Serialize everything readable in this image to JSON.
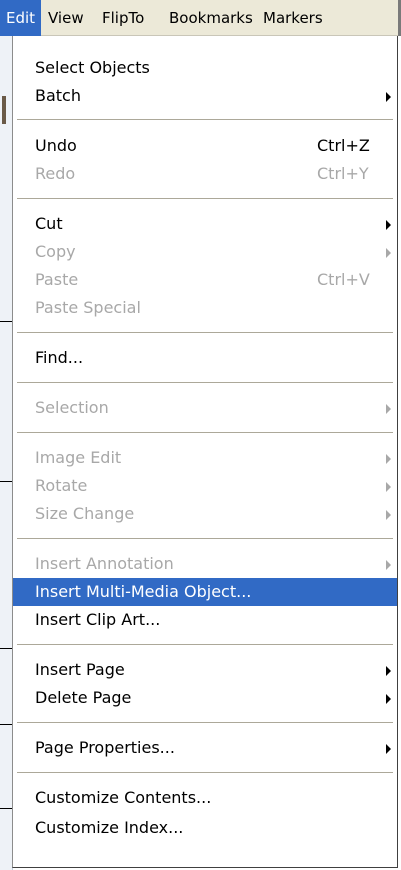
{
  "menubar": {
    "items": [
      "Edit",
      "View",
      "FlipTo",
      "Bookmarks",
      "Markers"
    ]
  },
  "menu": {
    "select_objects": "Select Objects",
    "batch": "Batch",
    "undo": "Undo",
    "undo_shortcut": "Ctrl+Z",
    "redo": "Redo",
    "redo_shortcut": "Ctrl+Y",
    "cut": "Cut",
    "copy": "Copy",
    "paste": "Paste",
    "paste_shortcut": "Ctrl+V",
    "paste_special": "Paste Special",
    "find": "Find...",
    "selection": "Selection",
    "image_edit": "Image Edit",
    "rotate": "Rotate",
    "size_change": "Size Change",
    "insert_annotation": "Insert Annotation",
    "insert_multimedia": "Insert Multi-Media Object...",
    "insert_clip_art": "Insert Clip Art...",
    "insert_page": "Insert Page",
    "delete_page": "Delete Page",
    "page_properties": "Page Properties...",
    "customize_contents": "Customize Contents...",
    "customize_index": "Customize Index..."
  },
  "colors": {
    "highlight": "#316ac5",
    "disabled_text": "#a8a8a8",
    "menubar_bg": "#ece9d8"
  }
}
